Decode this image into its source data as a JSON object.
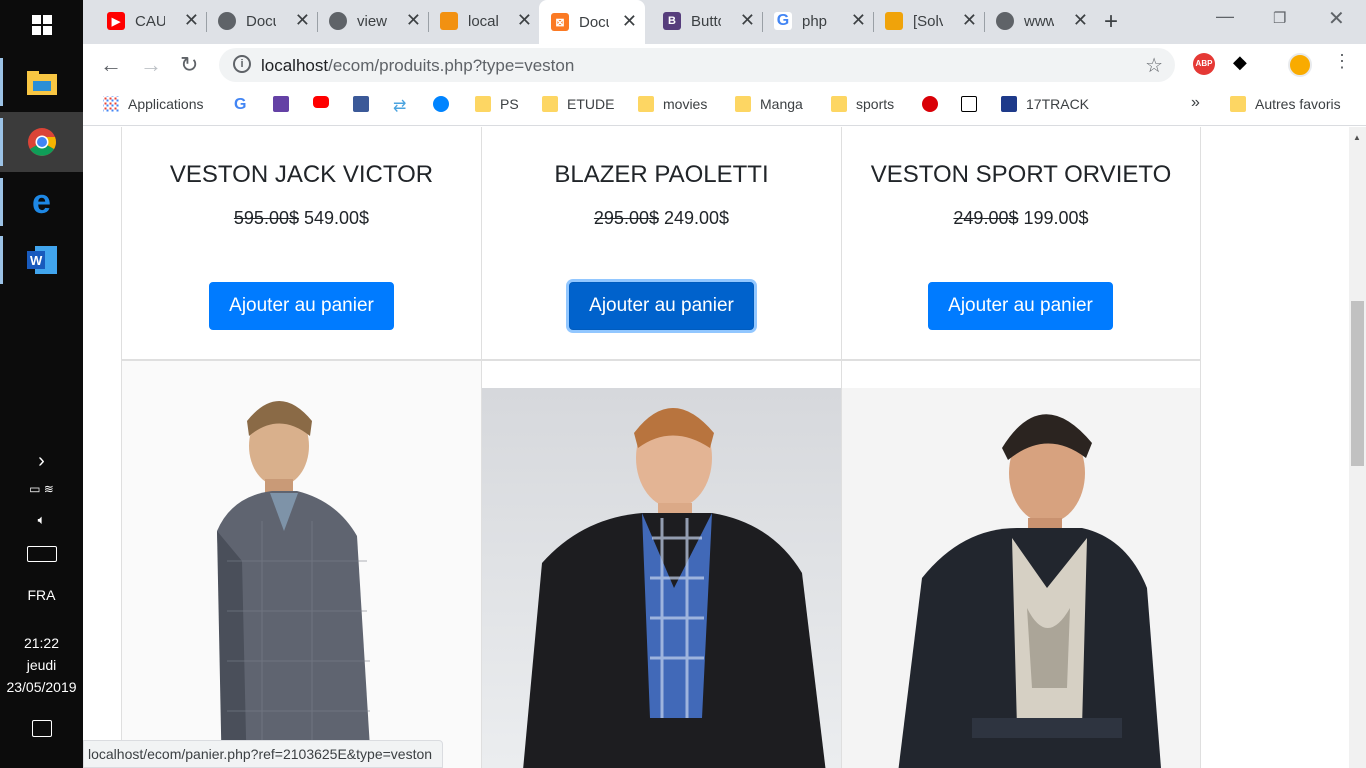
{
  "taskbar": {
    "time": "21:22",
    "day": "jeudi",
    "date": "23/05/2019",
    "language": "FRA"
  },
  "tabs": [
    {
      "label": "CAU",
      "icon": "youtube-icon",
      "color": "#ff0000"
    },
    {
      "label": "Docu",
      "icon": "globe-icon",
      "color": "#5f6368"
    },
    {
      "label": "view",
      "icon": "globe-icon",
      "color": "#5f6368"
    },
    {
      "label": "local",
      "icon": "phpmyadmin-icon",
      "color": "#f29111"
    },
    {
      "label": "Docu",
      "icon": "xampp-icon",
      "color": "#fb7a24"
    },
    {
      "label": "Butto",
      "icon": "bootstrap-icon",
      "color": "#563d7c"
    },
    {
      "label": "php",
      "icon": "google-icon",
      "color": "#4285f4"
    },
    {
      "label": "[Solv",
      "icon": "forum-icon",
      "color": "#f0a30a"
    },
    {
      "label": "www",
      "icon": "globe-icon",
      "color": "#5f6368"
    }
  ],
  "address": {
    "host": "localhost",
    "path": "/ecom/produits.php?type=veston"
  },
  "bookmarks": {
    "apps": "Applications",
    "ps": "PS",
    "etude": "ETUDE",
    "movies": "movies",
    "manga": "Manga",
    "sports": "sports",
    "track": "17TRACK",
    "other": "Autres favoris",
    "more": "»"
  },
  "products": [
    {
      "name": "VESTON JACK VICTOR",
      "old_price": "595.00$",
      "price": "549.00$",
      "button": "Ajouter au panier"
    },
    {
      "name": "BLAZER PAOLETTI",
      "old_price": "295.00$",
      "price": "249.00$",
      "button": "Ajouter au panier"
    },
    {
      "name": "VESTON SPORT ORVIETO",
      "old_price": "249.00$",
      "price": "199.00$",
      "button": "Ajouter au panier"
    }
  ],
  "status_url": "localhost/ecom/panier.php?ref=2103625E&type=veston",
  "colors": {
    "primary": "#007bff",
    "primary_active": "#0062cc"
  }
}
